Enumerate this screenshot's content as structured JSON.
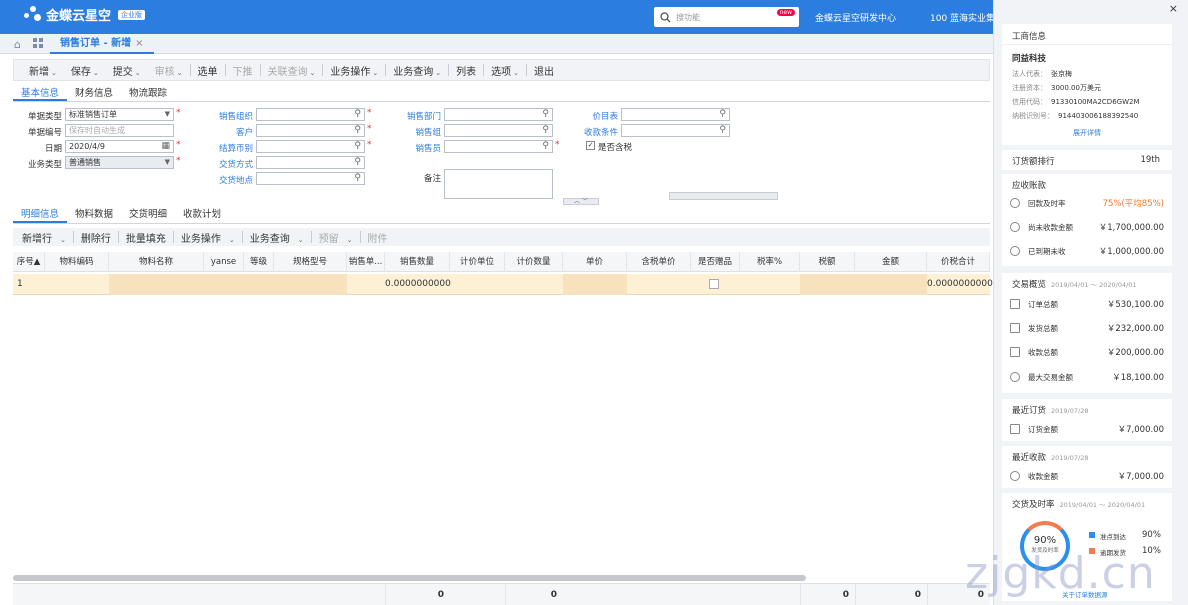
{
  "header": {
    "brand": "金蝶云星空",
    "brand_badge": "企业版",
    "search_placeholder": "搜功能",
    "search_badge": "new",
    "org_name": "金蝶云星空研发中心",
    "company": "100 蓝海实业集"
  },
  "doc_tab": {
    "title": "销售订单 - 新增",
    "close": "×"
  },
  "toolbar": {
    "items": [
      {
        "label": "新增",
        "caret": "⌄",
        "disabled": false
      },
      {
        "label": "保存",
        "caret": "⌄",
        "disabled": false
      },
      {
        "label": "提交",
        "caret": "⌄",
        "disabled": false
      },
      {
        "label": "审核",
        "caret": "⌄",
        "disabled": true
      },
      {
        "label": "选单",
        "caret": "",
        "disabled": false
      },
      {
        "label": "下推",
        "caret": "",
        "disabled": true
      },
      {
        "label": "关联查询",
        "caret": "⌄",
        "disabled": true
      },
      {
        "label": "业务操作",
        "caret": "⌄",
        "disabled": false
      },
      {
        "label": "业务查询",
        "caret": "⌄",
        "disabled": false
      },
      {
        "label": "列表",
        "caret": "",
        "disabled": false
      },
      {
        "label": "选项",
        "caret": "⌄",
        "disabled": false
      },
      {
        "label": "退出",
        "caret": "",
        "disabled": false
      }
    ]
  },
  "header_tabs": [
    "基本信息",
    "财务信息",
    "物流跟踪"
  ],
  "form": {
    "doc_type_label": "单据类型",
    "doc_type_value": "标准销售订单",
    "doc_no_label": "单据编号",
    "doc_no_placeholder": "保存时自动生成",
    "date_label": "日期",
    "date_value": "2020/4/9",
    "biz_type_label": "业务类型",
    "biz_type_value": "普通销售",
    "sales_org_label": "销售组织",
    "customer_label": "客户",
    "currency_label": "结算币别",
    "trade_method_label": "交货方式",
    "trade_place_label": "交货地点",
    "sales_dept_label": "销售部门",
    "sales_group_label": "销售组",
    "salesman_label": "销售员",
    "remark_label": "备注",
    "price_list_label": "价目表",
    "payment_terms_label": "收款条件",
    "tax_incl_label": "是否含税",
    "check_mark": "✓"
  },
  "detail_tabs": [
    "明细信息",
    "物料数据",
    "交货明细",
    "收款计划"
  ],
  "detail_toolbar": [
    {
      "label": "新增行",
      "caret": "⌄",
      "disabled": false
    },
    {
      "label": "删除行",
      "caret": "",
      "disabled": false
    },
    {
      "label": "批量填充",
      "caret": "",
      "disabled": false
    },
    {
      "label": "业务操作",
      "caret": "⌄",
      "disabled": false
    },
    {
      "label": "业务查询",
      "caret": "⌄",
      "disabled": false
    },
    {
      "label": "预留",
      "caret": "⌄",
      "disabled": true
    },
    {
      "label": "附件",
      "caret": "",
      "disabled": true
    }
  ],
  "grid": {
    "columns": [
      "序号▲",
      "物料编码",
      "物料名称",
      "yanse",
      "等级",
      "规格型号",
      "销售单...",
      "销售数量",
      "计价单位",
      "计价数量",
      "单价",
      "含税单价",
      "是否赠品",
      "税率%",
      "税额",
      "金额",
      "价税合计"
    ],
    "row": {
      "seq": "1",
      "qty": "0.0000000000",
      "total": "0.0000000000"
    },
    "footer": [
      "0",
      "0",
      "0",
      "0",
      "0",
      "0"
    ]
  },
  "panel": {
    "close": "×",
    "biz_info_title": "工商信息",
    "company_name": "同益科技",
    "legal_rep_label": "法人代表：",
    "legal_rep": "张京梅",
    "capital_label": "注册资本：",
    "capital": "3000.00万美元",
    "credit_code_label": "信用代码：",
    "credit_code": "91330100MA2CD6GW2M",
    "tax_id_label": "纳税识别号：",
    "tax_id": "914403006188392540",
    "expand_link": "展开详情",
    "rank_label": "订货额排行",
    "rank_value": "19th",
    "receivable_title": "应收账款",
    "receivables": [
      {
        "label": "回款及时率",
        "value": "75%(平均85%)",
        "icon": "clock-icon"
      },
      {
        "label": "尚未收款金额",
        "value": "￥1,700,000.00",
        "icon": "shield-icon"
      },
      {
        "label": "已到期未收",
        "value": "￥1,000,000.00",
        "icon": "alarm-icon"
      }
    ],
    "trade_title": "交易概览",
    "trade_range": "2019/04/01 ～ 2020/04/01",
    "trades": [
      {
        "label": "订单总额",
        "value": "￥530,100.00",
        "icon": "order-icon"
      },
      {
        "label": "发货总额",
        "value": "￥232,000.00",
        "icon": "delivery-icon"
      },
      {
        "label": "收款总额",
        "value": "￥200,000.00",
        "icon": "receipt-icon"
      },
      {
        "label": "最大交易金额",
        "value": "￥18,100.00",
        "icon": "chart-icon"
      }
    ],
    "recent_order_title": "最近订货",
    "recent_order_date": "2019/07/28",
    "recent_order_label": "订货金额",
    "recent_order_value": "￥7,000.00",
    "recent_receipt_title": "最近收款",
    "recent_receipt_date": "2019/07/28",
    "recent_receipt_label": "收款金额",
    "recent_receipt_value": "￥7,000.00",
    "delivery_title": "交货及时率",
    "delivery_range": "2019/04/01 ～ 2020/04/01",
    "ring_value": "90%",
    "ring_caption": "发货及时率",
    "legend": [
      {
        "label": "准点到达",
        "value": "90%",
        "color": "#2b8ff0"
      },
      {
        "label": "逾期发货",
        "value": "10%",
        "color": "#f07d50"
      }
    ],
    "footer_link": "关于订单数据源"
  },
  "watermark": "zjgkd.cn"
}
